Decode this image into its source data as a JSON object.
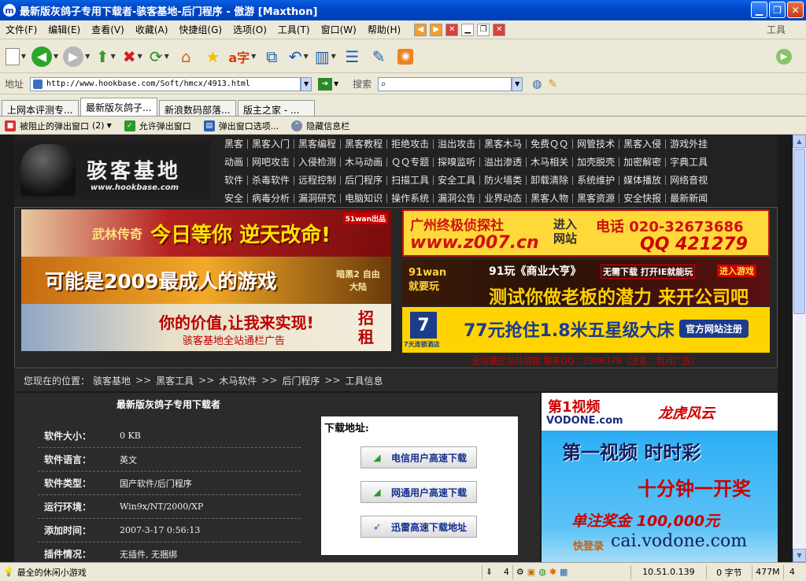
{
  "window": {
    "title": "最新版灰鸽子专用下载者-骇客基地-后门程序 - 傲游 [Maxthon]",
    "app_icon": "m"
  },
  "menubar": {
    "items": [
      "文件(F)",
      "编辑(E)",
      "查看(V)",
      "收藏(A)",
      "快捷组(G)",
      "选项(O)",
      "工具(T)",
      "窗口(W)",
      "帮助(H)"
    ],
    "right_label": "工具"
  },
  "address": {
    "label": "地址",
    "url": "http://www.hookbase.com/Soft/hmcx/4913.html",
    "search_label": "搜索",
    "search_value": ""
  },
  "tabs": [
    "上网本评测专...",
    "最新版灰鸽子...",
    "新浪数码部落...",
    "版主之家 - ..."
  ],
  "active_tab": 1,
  "popupbar": {
    "blocked": "被阻止的弹出窗口",
    "blocked_count": "(2)",
    "allow": "允许弹出窗口",
    "options": "弹出窗口选项...",
    "hide": "隐藏信息栏"
  },
  "site": {
    "logo_text": "骇客基地",
    "logo_url": "www.hookbase.com",
    "nav_rows": [
      [
        "黑客",
        "黑客入门",
        "黑客编程",
        "黑客教程",
        "拒绝攻击",
        "溢出攻击",
        "黑客木马",
        "免费ＱＱ",
        "网管技术",
        "黑客入侵",
        "游戏外挂"
      ],
      [
        "动画",
        "网吧攻击",
        "入侵检测",
        "木马动画",
        "ＱＱ专题",
        "探嗅监听",
        "溢出渗透",
        "木马相关",
        "加壳脱壳",
        "加密解密",
        "字典工具"
      ],
      [
        "软件",
        "杀毒软件",
        "远程控制",
        "后门程序",
        "扫描工具",
        "安全工具",
        "防火墙类",
        "卸载清除",
        "系统维护",
        "媒体播放",
        "网络音视"
      ],
      [
        "安全",
        "病毒分析",
        "漏洞研究",
        "电脑知识",
        "操作系统",
        "漏洞公告",
        "业界动态",
        "黑客人物",
        "黑客资源",
        "安全快报",
        "最新新闻"
      ]
    ],
    "ads": {
      "left1": "今日等你 逆天改命!",
      "left1_sub": "武林传奇",
      "left1_tag": "51wan出品",
      "left2": "可能是2009最成人的游戏",
      "left2_sub": "暗黑2 自由大陆",
      "left3": "你的价值,让我来实现!",
      "left3_sub": "骇客基地全站通栏广告",
      "left3_tag": "招租",
      "right1_top": "广州终极侦探社",
      "right1_url": "www.z007.cn",
      "right1_mid": "进入网站",
      "right1_phone": "电话 020-32673686",
      "right1_qq": "QQ 421279",
      "right2_title": "91玩《商业大亨》",
      "right2_tag": "无需下载 打开IE就能玩",
      "right2_btn": "进入游戏",
      "right2_main": "测试你做老板的潜力 来开公司吧",
      "right2_logo": "91wan 就要玩",
      "right3_logo": "7天连锁酒店",
      "right3_main": "77元抢住1.8米五星级大床",
      "right3_btn": "官方网站注册",
      "caption": "全站通栏包月招租 联系QQ：2306376（注名：包月广告）"
    },
    "breadcrumb": {
      "label": "您现在的位置：",
      "items": [
        "骇客基地",
        "黑客工具",
        "木马软件",
        "后门程序",
        "工具信息"
      ]
    },
    "detail": {
      "title": "最新版灰鸽子专用下载者",
      "rows": [
        {
          "label": "软件大小：",
          "value": "0 KB"
        },
        {
          "label": "软件语言：",
          "value": "英文"
        },
        {
          "label": "软件类型：",
          "value": "国产软件/后门程序"
        },
        {
          "label": "运行环境：",
          "value": "Win9x/NT/2000/XP"
        },
        {
          "label": "添加时间：",
          "value": "2007-3-17 0:56:13"
        },
        {
          "label": "插件情况：",
          "value": "无插件, 无捆绑"
        }
      ],
      "download_title": "下载地址:",
      "buttons": [
        "电信用户高速下载",
        "网通用户高速下载",
        "迅雷高速下载地址"
      ]
    },
    "side_ad": {
      "brand": "第1视频",
      "brand_sub": "VODONE.com",
      "partner": "龙虎风云",
      "line1": "第一视频 时时彩",
      "line2": "十分钟一开奖",
      "line3": "单注奖金 100,000元",
      "line4": "快登录",
      "url": "cai.vodone.com"
    }
  },
  "statusbar": {
    "text": "最全的休闲小游戏",
    "count": "4",
    "ip": "10.51.0.139",
    "bytes": "0 字节",
    "memory": "477M",
    "num": "4"
  }
}
